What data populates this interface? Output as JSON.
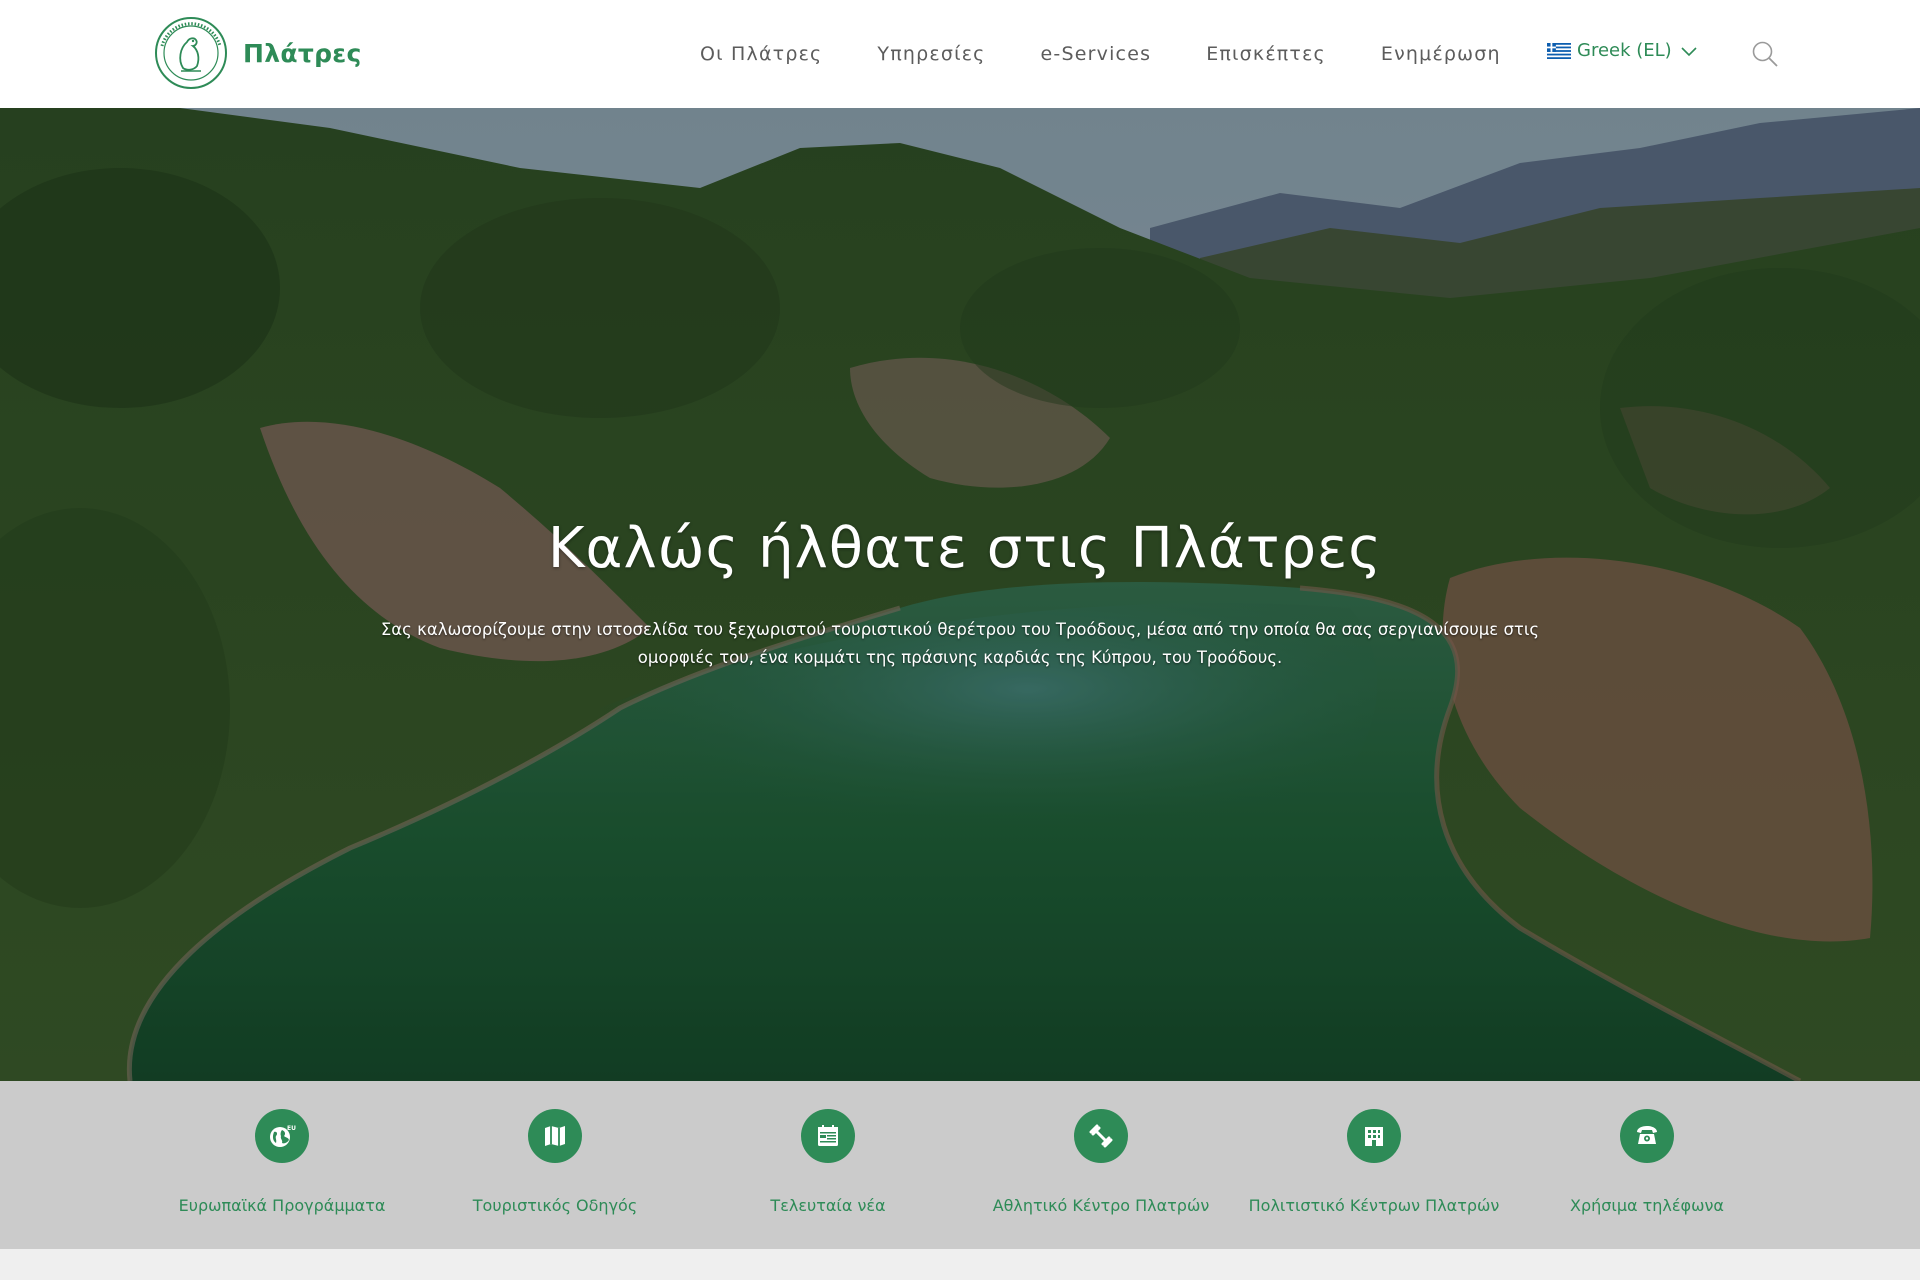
{
  "site": {
    "name": "Πλάτρες"
  },
  "nav": {
    "items": [
      {
        "label": "Οι Πλάτρες"
      },
      {
        "label": "Υπηρεσίες"
      },
      {
        "label": "e-Services"
      },
      {
        "label": "Επισκέπτες"
      },
      {
        "label": "Ενημέρωση"
      }
    ],
    "language": "Greek (EL)",
    "language_flag_icon": "greek-flag-icon",
    "search_icon": "search-icon"
  },
  "hero": {
    "title": "Καλώς ήλθατε στις Πλάτρες",
    "subtitle": "Σας καλωσορίζουμε στην ιστοσελίδα του ξεχωριστού τουριστικού θερέτρου του Τροόδους, μέσα από την οποία θα σας σεργιανίσουμε στις ομορφιές του, ένα κομμάτι της πράσινης καρδιάς της Κύπρου, του Τροόδους."
  },
  "quick_links": [
    {
      "label": "Ευρωπαϊκά Προγράμματα",
      "icon": "eu-globe-icon"
    },
    {
      "label": "Τουριστικός Οδηγός",
      "icon": "map-icon"
    },
    {
      "label": "Τελευταία νέα",
      "icon": "calendar-news-icon"
    },
    {
      "label": "Αθλητικό Κέντρο Πλατρών",
      "icon": "dumbbell-icon"
    },
    {
      "label": "Πολιτιστικό Κέντρων Πλατρών",
      "icon": "building-icon"
    },
    {
      "label": "Χρήσιμα τηλέφωνα",
      "icon": "phone-icon"
    }
  ],
  "colors": {
    "brand_green": "#2e8b57",
    "nav_text": "#5c5c5c",
    "quick_bar_bg": "#cbcbcb"
  }
}
